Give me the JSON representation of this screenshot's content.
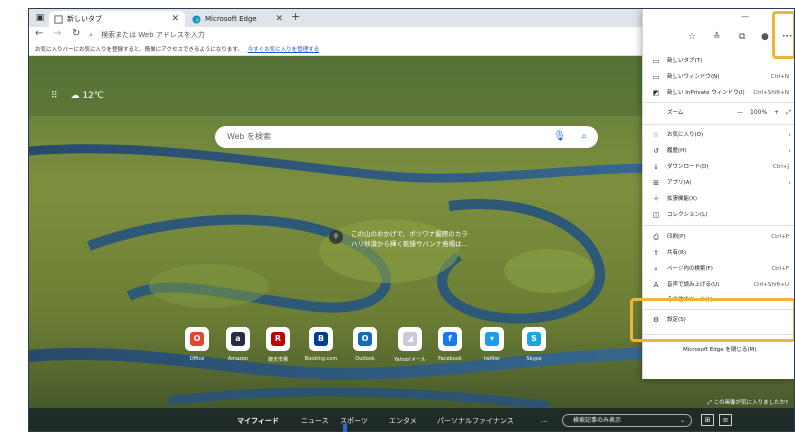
{
  "tabs": [
    {
      "label": "新しいタブ",
      "active": true
    },
    {
      "label": "Microsoft Edge",
      "active": false
    }
  ],
  "address": {
    "placeholder": "検索または Web アドレスを入力"
  },
  "favorites_bar": {
    "message": "お気に入りバーにお気に入りを登録すると、簡単にアクセスできるようになります。",
    "link": "今すぐお気に入りを管理する"
  },
  "weather": {
    "temp": "12℃"
  },
  "search": {
    "placeholder": "Web を検索"
  },
  "image_caption": {
    "line1": "この山のおかげで、ボツワナ最際のカラ",
    "line2": "ハリ砂漠から輝く乾燥サバンナ鳥場は..."
  },
  "tiles": [
    {
      "label": "Office",
      "icon": "office-icon",
      "color": "#e0472b",
      "glyph": "O"
    },
    {
      "label": "Amazon",
      "icon": "amazon-icon",
      "color": "#232f3e",
      "glyph": "a"
    },
    {
      "label": "楽天市場",
      "icon": "rakuten-icon",
      "color": "#bf0000",
      "glyph": "R"
    },
    {
      "label": "Booking.com",
      "icon": "booking-icon",
      "color": "#003b95",
      "glyph": "B"
    },
    {
      "label": "Outlook",
      "icon": "outlook-icon",
      "color": "#0f6cbd",
      "glyph": "O"
    },
    {
      "label": "Yahoo!メール",
      "icon": "yahoo-mail-icon",
      "color": "#c9c9d8",
      "glyph": "◢"
    },
    {
      "label": "Facebook",
      "icon": "facebook-icon",
      "color": "#1877f2",
      "glyph": "f"
    },
    {
      "label": "twitter",
      "icon": "twitter-icon",
      "color": "#1d9bf0",
      "glyph": "▾"
    },
    {
      "label": "Skype",
      "icon": "skype-icon",
      "color": "#16a6e0",
      "glyph": "S"
    }
  ],
  "hint": "この画像が気に入りましたか?",
  "feed": {
    "items": [
      "マイフィード",
      "ニュース",
      "スポーツ",
      "エンタメ",
      "パーソナルファイナンス",
      "..."
    ],
    "select": "検索記事のみ表示"
  },
  "menu": {
    "items": [
      {
        "icon": "new-tab-icon",
        "glyph": "▭",
        "label": "新しいタブ(T)",
        "shortcut": ""
      },
      {
        "icon": "new-window-icon",
        "glyph": "▭",
        "label": "新しいウィンドウ(N)",
        "shortcut": "Ctrl+N"
      },
      {
        "icon": "inprivate-icon",
        "glyph": "◩",
        "label": "新しい InPrivate ウィンドウ(I)",
        "shortcut": "Ctrl+Shift+N"
      },
      {
        "icon": "",
        "glyph": "",
        "label": "ズーム",
        "shortcut": ""
      },
      {
        "icon": "favorites-icon",
        "glyph": "☆",
        "label": "お気に入り(O)",
        "shortcut": ""
      },
      {
        "icon": "history-icon",
        "glyph": "↺",
        "label": "履歴(H)",
        "shortcut": ""
      },
      {
        "icon": "download-icon",
        "glyph": "↓",
        "label": "ダウンロード(D)",
        "shortcut": "Ctrl+J"
      },
      {
        "icon": "apps-icon",
        "glyph": "⊞",
        "label": "アプリ(A)",
        "shortcut": ""
      },
      {
        "icon": "extensions-icon",
        "glyph": "✧",
        "label": "拡張機能(X)",
        "shortcut": ""
      },
      {
        "icon": "collections-icon",
        "glyph": "◫",
        "label": "コレクション(L)",
        "shortcut": ""
      },
      {
        "icon": "print-icon",
        "glyph": "⎙",
        "label": "印刷(P)",
        "shortcut": "Ctrl+P"
      },
      {
        "icon": "share-icon",
        "glyph": "⇪",
        "label": "共有(R)",
        "shortcut": ""
      },
      {
        "icon": "find-icon",
        "glyph": "⌕",
        "label": "ページ内の検索(F)",
        "shortcut": "Ctrl+F"
      },
      {
        "icon": "read-aloud-icon",
        "glyph": "A",
        "label": "音声で読み上げる(U)",
        "shortcut": "Ctrl+Shift+U"
      },
      {
        "icon": "",
        "glyph": "",
        "label": "その他のツール(L)",
        "shortcut": ""
      },
      {
        "icon": "settings-icon",
        "glyph": "⚙",
        "label": "設定(S)",
        "shortcut": ""
      },
      {
        "icon": "",
        "glyph": "",
        "label": "Microsoft Edge を閉じる(M)",
        "shortcut": ""
      }
    ],
    "zoom": {
      "value": "100%",
      "minus": "—",
      "plus": "+",
      "expand": "⤢"
    }
  },
  "colors": {
    "highlight": "#f0b43a",
    "edge_blue": "#1a6ddc"
  }
}
